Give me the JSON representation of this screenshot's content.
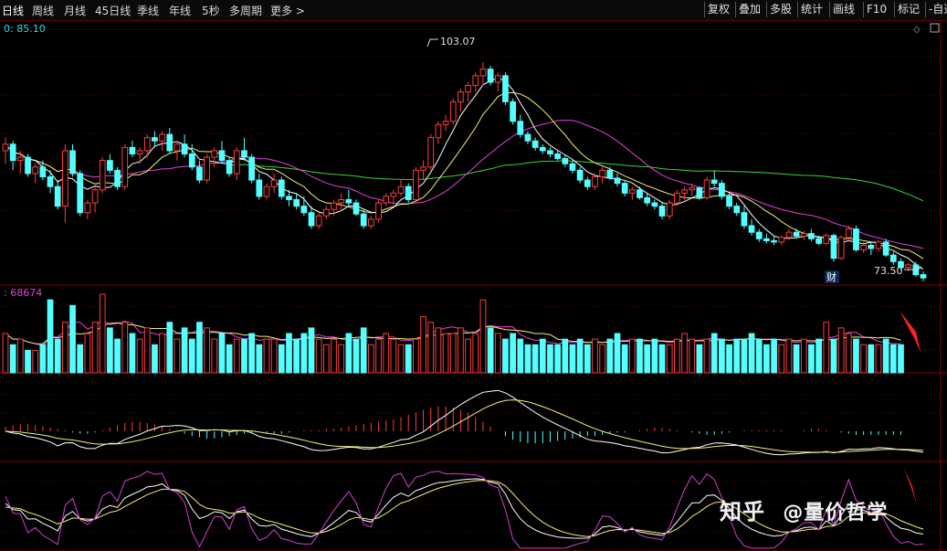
{
  "toolbar": {
    "periods": [
      "日线",
      "周线",
      "月线",
      "45日线",
      "季线",
      "年线",
      "5秒",
      "多周期",
      "更多 >"
    ],
    "right_buttons": [
      "复权",
      "叠加",
      "多股",
      "统计",
      "画线",
      "F10",
      "标记",
      "-自选"
    ]
  },
  "price_panel": {
    "ma_readout": "0: 85.10",
    "high_label": "103.07",
    "low_label": "73.50",
    "fin_badge": "财",
    "price_range": [
      71,
      107
    ],
    "candles": [
      [
        89.5,
        91.5,
        87.5,
        90.5
      ],
      [
        90.5,
        91,
        86.5,
        88
      ],
      [
        88,
        89.5,
        86,
        88.5
      ],
      [
        88.5,
        89,
        85.5,
        86
      ],
      [
        86,
        87.5,
        84.5,
        87
      ],
      [
        87,
        88,
        85,
        85.5
      ],
      [
        85.5,
        86.5,
        83,
        84
      ],
      [
        84,
        85,
        80.5,
        81
      ],
      [
        81,
        90.5,
        78.5,
        89.5
      ],
      [
        89.5,
        90.5,
        85.5,
        86
      ],
      [
        86,
        86.5,
        79.5,
        80
      ],
      [
        80,
        82,
        79,
        81.5
      ],
      [
        81.5,
        84,
        80,
        83.5
      ],
      [
        83.5,
        88.5,
        83,
        88
      ],
      [
        88,
        89,
        86,
        86.5
      ],
      [
        86.5,
        87,
        83.5,
        84
      ],
      [
        84,
        90.5,
        83.5,
        90
      ],
      [
        90,
        91,
        88.5,
        89
      ],
      [
        89,
        90,
        87.5,
        89.5
      ],
      [
        89.5,
        92,
        88.5,
        91.5
      ],
      [
        91.5,
        92.5,
        90,
        91
      ],
      [
        91,
        92.5,
        89.5,
        92
      ],
      [
        92,
        93,
        89,
        89.5
      ],
      [
        89.5,
        91,
        88,
        90.5
      ],
      [
        90.5,
        92,
        88.5,
        89
      ],
      [
        89,
        90.5,
        86.5,
        87
      ],
      [
        87,
        88,
        84.5,
        85
      ],
      [
        85,
        89,
        84.5,
        88.5
      ],
      [
        88.5,
        90,
        87,
        89.5
      ],
      [
        89.5,
        91,
        87.5,
        88
      ],
      [
        88,
        88.5,
        85.5,
        86
      ],
      [
        86,
        90,
        85,
        89.5
      ],
      [
        89.5,
        91.5,
        88,
        88.5
      ],
      [
        88.5,
        89,
        84.5,
        85
      ],
      [
        85,
        86,
        82,
        82.5
      ],
      [
        82.5,
        84.5,
        82,
        84
      ],
      [
        84,
        86,
        83,
        85
      ],
      [
        85,
        85.5,
        82,
        82.5
      ],
      [
        82.5,
        83.5,
        81,
        82
      ],
      [
        82,
        83,
        80.5,
        81
      ],
      [
        81,
        82.5,
        79.5,
        80
      ],
      [
        80,
        81,
        77.5,
        78
      ],
      [
        78,
        80,
        77.5,
        79.5
      ],
      [
        79.5,
        81,
        79,
        80.5
      ],
      [
        80.5,
        82,
        79.5,
        81.5
      ],
      [
        81.5,
        83,
        80.5,
        82
      ],
      [
        82,
        83.5,
        81,
        81.5
      ],
      [
        81.5,
        82,
        79.5,
        79.8
      ],
      [
        79.8,
        80.5,
        77.5,
        78
      ],
      [
        78,
        79.5,
        77.5,
        79
      ],
      [
        79,
        82,
        78.5,
        81.5
      ],
      [
        81.5,
        83,
        81,
        82.5
      ],
      [
        82.5,
        83.5,
        81.5,
        83
      ],
      [
        83,
        85,
        82.5,
        84
      ],
      [
        84,
        84.5,
        81.5,
        82
      ],
      [
        82,
        87,
        81.5,
        86.5
      ],
      [
        86.5,
        88,
        85,
        87
      ],
      [
        87,
        92,
        86.5,
        91.5
      ],
      [
        91.5,
        94,
        90.5,
        93.5
      ],
      [
        93.5,
        95,
        92.5,
        94
      ],
      [
        94,
        97.5,
        93.5,
        97
      ],
      [
        97,
        99,
        95.5,
        98.5
      ],
      [
        98.5,
        100,
        97,
        99.5
      ],
      [
        99.5,
        101.5,
        98.5,
        101
      ],
      [
        101,
        103.07,
        99.5,
        102
      ],
      [
        102,
        102.5,
        99.5,
        100
      ],
      [
        100,
        101.5,
        98.5,
        101
      ],
      [
        101,
        101.5,
        96.5,
        97
      ],
      [
        97,
        97.5,
        93.5,
        94
      ],
      [
        94,
        95,
        91.5,
        92
      ],
      [
        92,
        92.5,
        90.5,
        91
      ],
      [
        91,
        91.5,
        89.5,
        90
      ],
      [
        90,
        90.5,
        89,
        89.5
      ],
      [
        89.5,
        90,
        88.5,
        89
      ],
      [
        89,
        89.5,
        88,
        88.3
      ],
      [
        88.3,
        88.8,
        87,
        87.5
      ],
      [
        87.5,
        88,
        86,
        86.5
      ],
      [
        86.5,
        87,
        84.5,
        85
      ],
      [
        85,
        85.5,
        83.5,
        84
      ],
      [
        84,
        86,
        83.5,
        85.5
      ],
      [
        85.5,
        87,
        84.5,
        86.5
      ],
      [
        86.5,
        87,
        85,
        85.3
      ],
      [
        85.3,
        86,
        84,
        84.5
      ],
      [
        84.5,
        85,
        82.5,
        83
      ],
      [
        83,
        84,
        82,
        83.5
      ],
      [
        83.5,
        84,
        82,
        82.3
      ],
      [
        82.3,
        83,
        81,
        81.5
      ],
      [
        81.5,
        82,
        80.5,
        81
      ],
      [
        81,
        81.5,
        79,
        79.5
      ],
      [
        79.5,
        82,
        79,
        81.5
      ],
      [
        81.5,
        83.5,
        81,
        83
      ],
      [
        83,
        84,
        82,
        83.5
      ],
      [
        83.5,
        84.5,
        82.5,
        83.8
      ],
      [
        83.8,
        84,
        82,
        82.3
      ],
      [
        82.3,
        85.5,
        82,
        85
      ],
      [
        85,
        86.5,
        84,
        84.5
      ],
      [
        84.5,
        85,
        82,
        82.5
      ],
      [
        82.5,
        83,
        80.5,
        81
      ],
      [
        81,
        81.5,
        79.5,
        80
      ],
      [
        80,
        81,
        77.5,
        78
      ],
      [
        78,
        79,
        76.5,
        77
      ],
      [
        77,
        77.5,
        75.5,
        76
      ],
      [
        76,
        76.8,
        75.3,
        75.7
      ],
      [
        75.7,
        76.5,
        75,
        75.5
      ],
      [
        75.5,
        76.5,
        75,
        76.2
      ],
      [
        76.2,
        77.5,
        75.8,
        77
      ],
      [
        77,
        77.6,
        76,
        76.4
      ],
      [
        76.4,
        77.2,
        75.8,
        76.8
      ],
      [
        76.8,
        77.5,
        75.6,
        76
      ],
      [
        76,
        76.5,
        75,
        75.3
      ],
      [
        75.3,
        76.8,
        75,
        76.5
      ],
      [
        76.5,
        76.8,
        72.5,
        73
      ],
      [
        73,
        76.5,
        72.8,
        76.2
      ],
      [
        76.2,
        78,
        75.5,
        77.5
      ],
      [
        77.5,
        78,
        74,
        74.3
      ],
      [
        74.3,
        75.5,
        73.8,
        75
      ],
      [
        75,
        75.5,
        73.5,
        74.5
      ],
      [
        74.5,
        75.8,
        74,
        75.5
      ],
      [
        75.5,
        76,
        73.2,
        73.5
      ],
      [
        73.5,
        74,
        72,
        72.5
      ],
      [
        72.5,
        73,
        71.2,
        71.6
      ],
      [
        71.6,
        72.3,
        71,
        72
      ],
      [
        72,
        72.5,
        70.2,
        70.5
      ],
      [
        70.5,
        71,
        69.5,
        70
      ]
    ]
  },
  "volume_panel": {
    "readout": ": 68674",
    "volumes": [
      7,
      5,
      6,
      4,
      4,
      5,
      13,
      6,
      9,
      12,
      5,
      7,
      9,
      14,
      8,
      6,
      9,
      7,
      6,
      8,
      5,
      7,
      9,
      6,
      8,
      6,
      9,
      8,
      6,
      7,
      5,
      6,
      6,
      7,
      5,
      6,
      6,
      5,
      7,
      6,
      7,
      8,
      6,
      5,
      6,
      5,
      7,
      6,
      8,
      5,
      6,
      7,
      6,
      5,
      5,
      6,
      10,
      9,
      8,
      7,
      7,
      8,
      6,
      7,
      13,
      8,
      7,
      6,
      7,
      6,
      5,
      5,
      6,
      5,
      5,
      6,
      5,
      6,
      5,
      6,
      5,
      6,
      7,
      5,
      6,
      6,
      5,
      6,
      5,
      5,
      6,
      7,
      6,
      5,
      6,
      7,
      6,
      5,
      6,
      6,
      7,
      6,
      5,
      6,
      5,
      6,
      5,
      6,
      5,
      6,
      9,
      6,
      8,
      7,
      6,
      5,
      5,
      5,
      6,
      5,
      5
    ]
  },
  "macd_panel": {
    "bars": [
      2,
      2.5,
      3,
      3,
      2.5,
      2,
      1.5,
      1,
      0.5,
      -0.5,
      -1,
      -1,
      -0.5,
      0.5,
      1.5,
      2.5,
      3.5,
      4,
      4,
      3.5,
      3,
      2,
      1,
      0,
      -1,
      -2,
      -2.5,
      -3,
      -3,
      -2.5,
      -2,
      -1.5,
      -1,
      -0.5,
      0,
      -0.5,
      -1,
      -1,
      -0.5,
      0,
      0.5,
      0.5,
      0.5,
      1,
      1,
      1.5,
      2,
      2.5,
      3,
      3.5,
      4,
      4.5,
      5,
      6,
      7,
      8,
      9,
      10,
      10.5,
      10.5,
      10,
      9,
      8,
      6,
      4,
      2,
      0,
      -2,
      -3.5,
      -4.5,
      -5,
      -5,
      -5,
      -4.5,
      -4,
      -3.5,
      -3,
      -2.5,
      -2,
      -2,
      -1.5,
      -1,
      -0.5,
      -0.5,
      0,
      0.5,
      1,
      1.5,
      1.5,
      1,
      0.5,
      0,
      -0.5,
      -1,
      -1.5,
      -1.5,
      -1,
      -0.5,
      0,
      0.5,
      0.5,
      0.5,
      0.5,
      0.5,
      0.5,
      0,
      0,
      0.5,
      1,
      1,
      0.5,
      0,
      -0.5,
      -1,
      -1.5,
      -1.5,
      -1.5,
      -1.5,
      -1.5,
      -1.5,
      -1.5
    ]
  },
  "watermark": {
    "platform": "知乎",
    "author": "@量价哲学"
  },
  "colors": {
    "up": "#ff3c3c",
    "down": "#54ffff",
    "ma5": "#ffffff",
    "ma10": "#f0f07a",
    "ma20": "#e040e0",
    "ma60": "#39d439",
    "grid": "#6b0000",
    "arrow": "#ff2020"
  }
}
